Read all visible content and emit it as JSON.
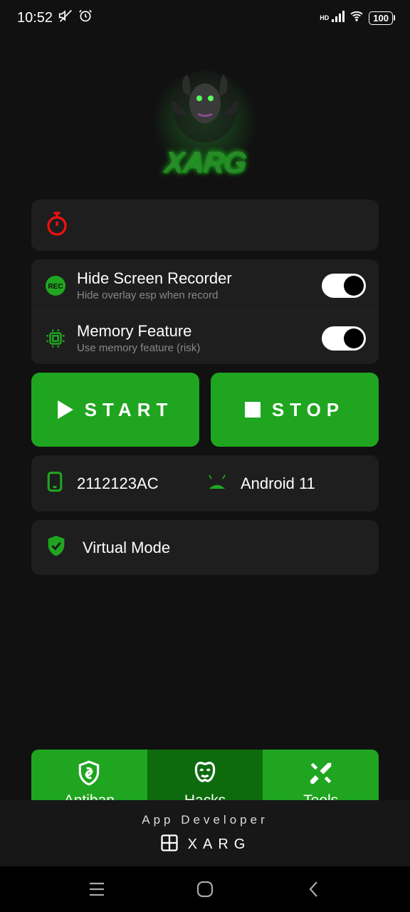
{
  "status": {
    "time": "10:52",
    "hd": "HD",
    "battery": "100"
  },
  "logo": {
    "text": "XARG"
  },
  "toggles": {
    "recorder": {
      "title": "Hide Screen Recorder",
      "sub": "Hide overlay esp when record"
    },
    "memory": {
      "title": "Memory Feature",
      "sub": "Use memory feature (risk)"
    }
  },
  "buttons": {
    "start": "START",
    "stop": "STOP"
  },
  "device": {
    "model": "2112123AC",
    "os": "Android 11",
    "mode": "Virtual Mode"
  },
  "tabs": {
    "antiban": "Antiban",
    "hacks": "Hacks",
    "tools": "Tools"
  },
  "footer": {
    "title": "App Developer",
    "brand": "XARG"
  }
}
